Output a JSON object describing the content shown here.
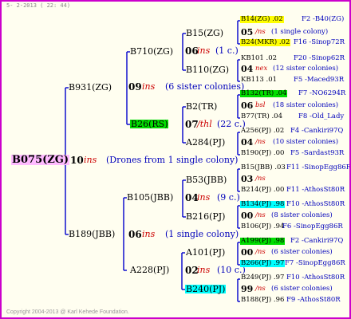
{
  "header": "5-  2-2013 ( 22: 44)",
  "footer": "Copyright 2004-2013 @ Karl Kehede Foundation.",
  "colors": {
    "border": "#cc00cc",
    "root_bg": "#ffbbff",
    "yellow": "#ffff00",
    "green": "#00dd00",
    "cyan": "#00ffff",
    "line": "#0000cc",
    "ins": "#cc0000",
    "note": "#0000bb"
  },
  "root": {
    "name": "B075(ZG)",
    "gen": "10",
    "ins": "ins",
    "note": "(Drones from 1 single colony)"
  },
  "l1": [
    {
      "name": "B931(ZG)",
      "gen": "09",
      "ins": "ins",
      "note": "(6 sister colonies)"
    },
    {
      "name": "B189(JBB)",
      "gen": "06",
      "ins": "ins",
      "note": "(1 single colony)"
    }
  ],
  "l2": [
    {
      "name": "B710(ZG)",
      "gen": "06",
      "ins": "ins",
      "note": "(1 c.)"
    },
    {
      "name": "B26(RS)",
      "gen": "07",
      "ins": "/thl",
      "note": "(22 c.)"
    },
    {
      "name": "B105(JBB)",
      "gen": "04",
      "ins": "ins",
      "note": "(9 c.)"
    },
    {
      "name": "A228(PJ)",
      "gen": "02",
      "ins": "ins",
      "note": "(10 c.)"
    }
  ],
  "l3": [
    {
      "name": "B15(ZG)"
    },
    {
      "name": "B110(ZG)"
    },
    {
      "name": "B2(TR)"
    },
    {
      "name": "A284(PJ)"
    },
    {
      "name": "B53(JBB)"
    },
    {
      "name": "B216(PJ)"
    },
    {
      "name": "A101(PJ)"
    },
    {
      "name": "B240(PJ)"
    }
  ],
  "l4": [
    {
      "mom": "B14(ZG) .02",
      "mom_tail": "F2 -B40(ZG)",
      "gen": "05",
      "ins": "/ns",
      "note": "(1 single colony)",
      "dad": "B24(MKR) .02",
      "dad_tail": "F16 -Sinop72R"
    },
    {
      "mom": "KB101 .02",
      "mom_tail": "F20 -Sinop62R",
      "gen": "04",
      "ins": "nex",
      "note": "(12 sister colonies)",
      "dad": "KB113 .01",
      "dad_tail": "F5 -Maced93R"
    },
    {
      "mom": "B132(TR) .04",
      "mom_tail": "F7 -NO6294R",
      "gen": "06",
      "ins": "bsl",
      "note": "(18 sister colonies)",
      "dad": "B77(TR) .04",
      "dad_tail": "F8 -Old_Lady"
    },
    {
      "mom": "A256(PJ) .02",
      "mom_tail": "F4 -Cankiri97Q",
      "gen": "04",
      "ins": "/ns",
      "note": "(10 sister colonies)",
      "dad": "B190(PJ) .00",
      "dad_tail": "F5 -Sardast93R"
    },
    {
      "mom": "B15(JBB) .03",
      "mom_tail": "F11 -SinopEgg86R",
      "gen": "03",
      "ins": "/ns",
      "note": "",
      "dad": "B214(PJ) .00",
      "dad_tail": "F11 -AthosSt80R"
    },
    {
      "mom": "B134(PJ) .98",
      "mom_tail": "F10 -AthosSt80R",
      "gen": "00",
      "ins": "/ns",
      "note": "(8 sister colonies)",
      "dad": "B106(PJ) .94",
      "dad_tail": "F6 -SinopEgg86R"
    },
    {
      "mom": "A199(PJ) .98",
      "mom_tail": "F2 -Cankiri97Q",
      "gen": "00",
      "ins": "/ns",
      "note": "(6 sister colonies)",
      "dad": "B266(PJ) .97",
      "dad_tail": "F7 -SinopEgg86R"
    },
    {
      "mom": "B249(PJ) .97",
      "mom_tail": "F10 -AthosSt80R",
      "gen": "99",
      "ins": "/ns",
      "note": "(6 sister colonies)",
      "dad": "B188(PJ) .96",
      "dad_tail": "F9 -AthosSt80R"
    }
  ]
}
